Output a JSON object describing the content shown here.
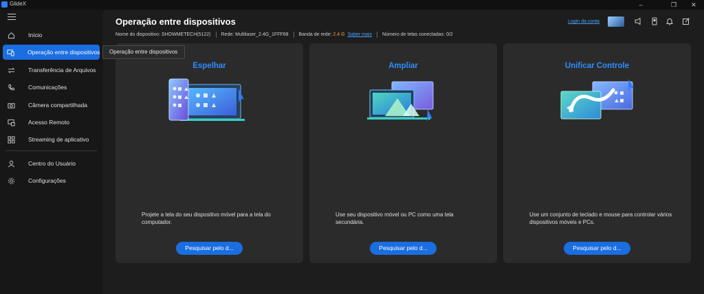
{
  "window": {
    "title": "GlideX",
    "minimize_glyph": "–",
    "restore_glyph": "❐",
    "close_glyph": "✕"
  },
  "sidebar": {
    "items": [
      {
        "label": "Início",
        "icon": "home-icon"
      },
      {
        "label": "Operação entre dispositivos",
        "icon": "cross-device-icon",
        "active": true
      },
      {
        "label": "Transferência de Arquivos",
        "icon": "transfer-icon"
      },
      {
        "label": "Comunicações",
        "icon": "phone-icon"
      },
      {
        "label": "Câmera compartilhada",
        "icon": "camera-icon"
      },
      {
        "label": "Acesso Remoto",
        "icon": "remote-access-icon"
      },
      {
        "label": "Streaming de aplicativo",
        "icon": "app-grid-icon"
      },
      {
        "label": "Centro do Usuário",
        "icon": "user-icon"
      },
      {
        "label": "Configurações",
        "icon": "gear-icon"
      }
    ]
  },
  "tooltip": "Operação entre dispositivos",
  "header": {
    "title": "Operação entre dispositivos",
    "device_name": "Nome do dispositivo: SHOWMETECH(5122)",
    "network": "Rede: Multilaser_2.4G_1FFF68",
    "bandwidth_label": "Banda de rede:",
    "bandwidth_value": "2.4 G",
    "learn_more": "Saber mais",
    "connected_screens": "Número de telas conectadas: 0/2",
    "login": "Login da conta"
  },
  "toolbar_icons": [
    "feedback-icon",
    "phone-device-icon",
    "bell-icon",
    "edit-icon"
  ],
  "colors": {
    "accent": "#1a6ee0",
    "title_blue": "#2e8dff",
    "bandwidth": "#ff9b3d",
    "card_bg": "#2b2b2b"
  },
  "cards": [
    {
      "title": "Espelhar",
      "description": "Projete a tela do seu dispositivo móvel para a tela do computador.",
      "button": "Pesquisar pelo d..."
    },
    {
      "title": "Ampliar",
      "description": "Use seu dispositivo móvel ou PC como uma tela secundária.",
      "button": "Pesquisar pelo d..."
    },
    {
      "title": "Unificar Controle",
      "description": "Use um conjunto de teclado e mouse para controlar vários dispositivos móveis e PCs.",
      "button": "Pesquisar pelo d..."
    }
  ]
}
